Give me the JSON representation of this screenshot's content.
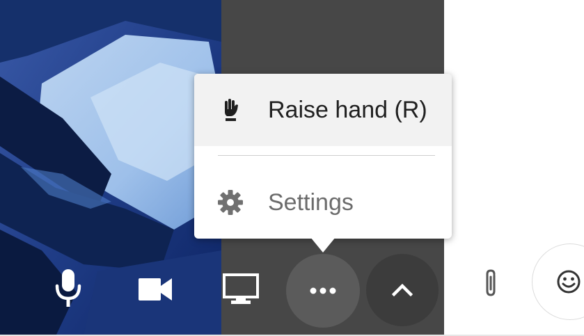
{
  "menu": {
    "items": [
      {
        "label": "Raise hand (R)",
        "icon": "raise-hand-icon"
      },
      {
        "label": "Settings",
        "icon": "gear-icon"
      }
    ]
  },
  "toolbar": {
    "buttons": [
      {
        "icon": "microphone-icon"
      },
      {
        "icon": "video-camera-icon"
      },
      {
        "icon": "screen-share-icon"
      },
      {
        "icon": "more-options-icon"
      },
      {
        "icon": "chevron-up-icon"
      }
    ]
  },
  "chat": {
    "buttons": [
      {
        "icon": "paperclip-icon"
      },
      {
        "icon": "emoji-icon"
      }
    ]
  },
  "colors": {
    "dark_panel": "#474747",
    "more_button": "#5b5b5b",
    "chevron_button": "#3c3c3c",
    "menu_highlight": "#f2f2f2"
  }
}
